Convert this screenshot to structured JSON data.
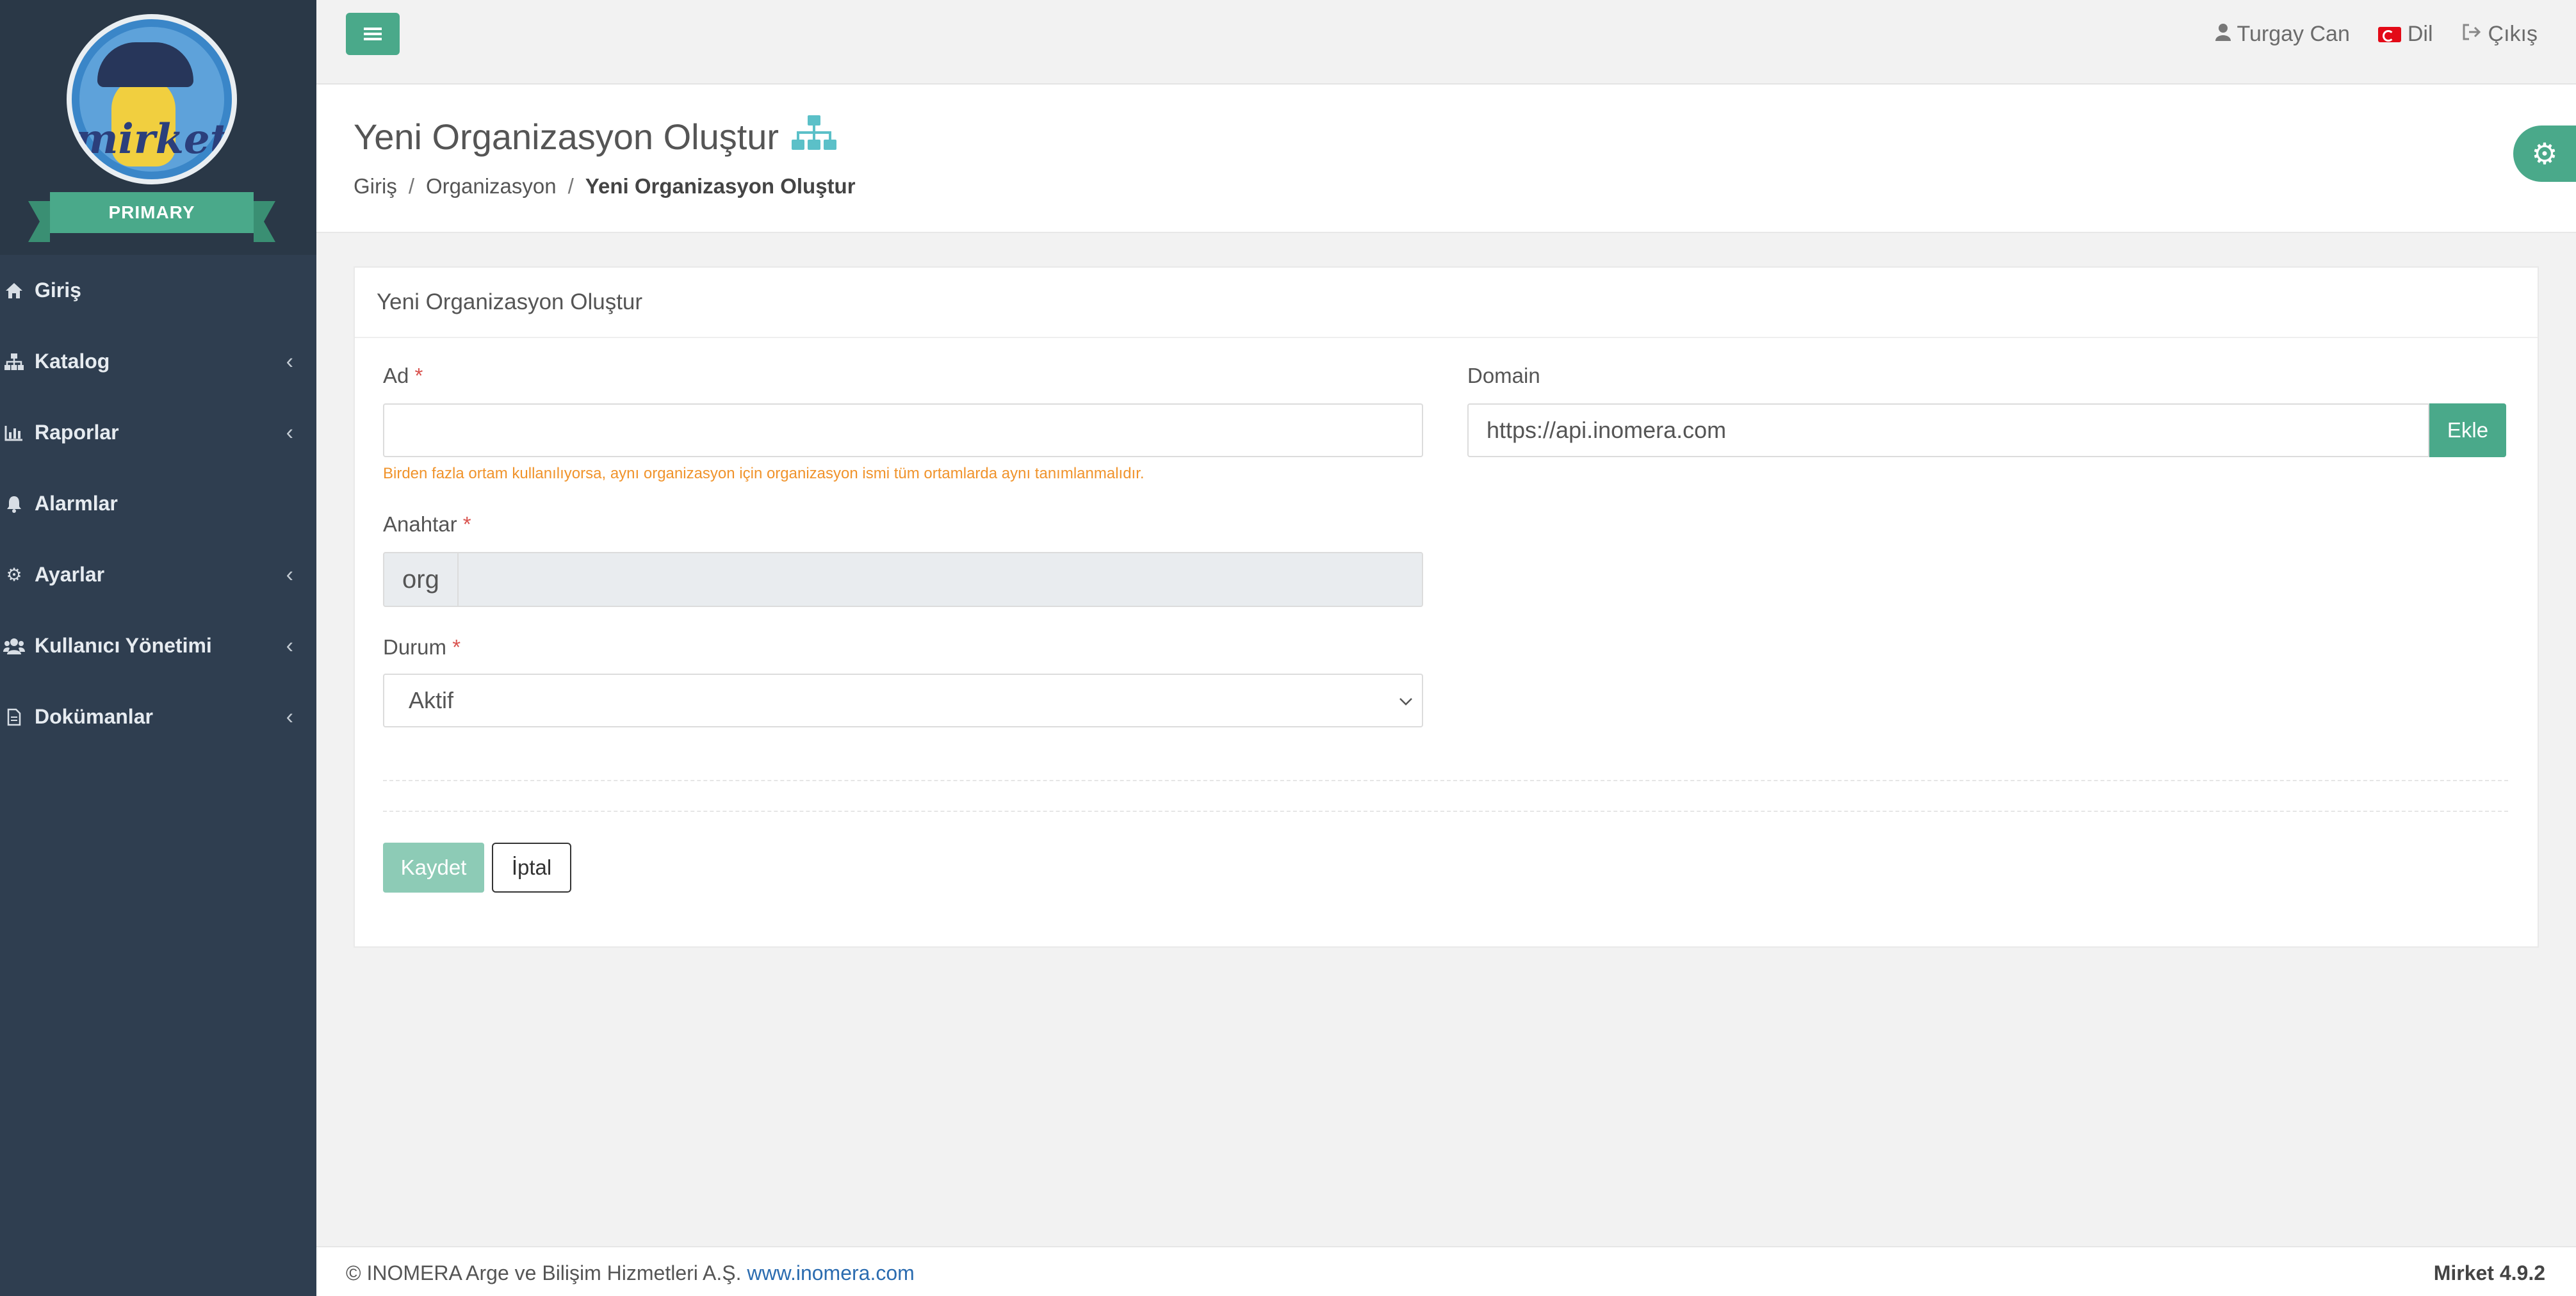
{
  "sidebar": {
    "logo_text": "mirket",
    "badge": "PRIMARY",
    "items": [
      {
        "label": "Giriş",
        "icon": "home-icon",
        "has_chevron": false
      },
      {
        "label": "Katalog",
        "icon": "sitemap-icon",
        "has_chevron": true
      },
      {
        "label": "Raporlar",
        "icon": "chart-icon",
        "has_chevron": true
      },
      {
        "label": "Alarmlar",
        "icon": "bell-icon",
        "has_chevron": false
      },
      {
        "label": "Ayarlar",
        "icon": "gears-icon",
        "has_chevron": true
      },
      {
        "label": "Kullanıcı Yönetimi",
        "icon": "users-icon",
        "has_chevron": true
      },
      {
        "label": "Dokümanlar",
        "icon": "document-icon",
        "has_chevron": true
      }
    ]
  },
  "header": {
    "user_name": "Turgay Can",
    "language_label": "Dil",
    "logout_label": "Çıkış"
  },
  "page": {
    "title": "Yeni Organizasyon Oluştur",
    "breadcrumb": [
      "Giriş",
      "Organizasyon",
      "Yeni Organizasyon Oluştur"
    ]
  },
  "form": {
    "card_title": "Yeni Organizasyon Oluştur",
    "name_label": "Ad",
    "name_value": "",
    "name_hint": "Birden fazla ortam kullanılıyorsa, aynı organizasyon için organizasyon ismi tüm ortamlarda aynı tanımlanmalıdır.",
    "key_label": "Anahtar",
    "key_prefix": "org",
    "status_label": "Durum",
    "status_value": "Aktif",
    "domain_label": "Domain",
    "domain_value": "https://api.inomera.com",
    "add_label": "Ekle",
    "required_mark": "*",
    "save_label": "Kaydet",
    "cancel_label": "İptal"
  },
  "footer": {
    "copyright": "© INOMERA Arge ve Bilişim Hizmetleri A.Ş.",
    "link": "www.inomera.com",
    "version": "Mirket 4.9.2"
  },
  "colors": {
    "accent": "#4aa98a",
    "sidebar": "#2f3e50",
    "hint": "#f0932b",
    "required": "#d9534f"
  }
}
